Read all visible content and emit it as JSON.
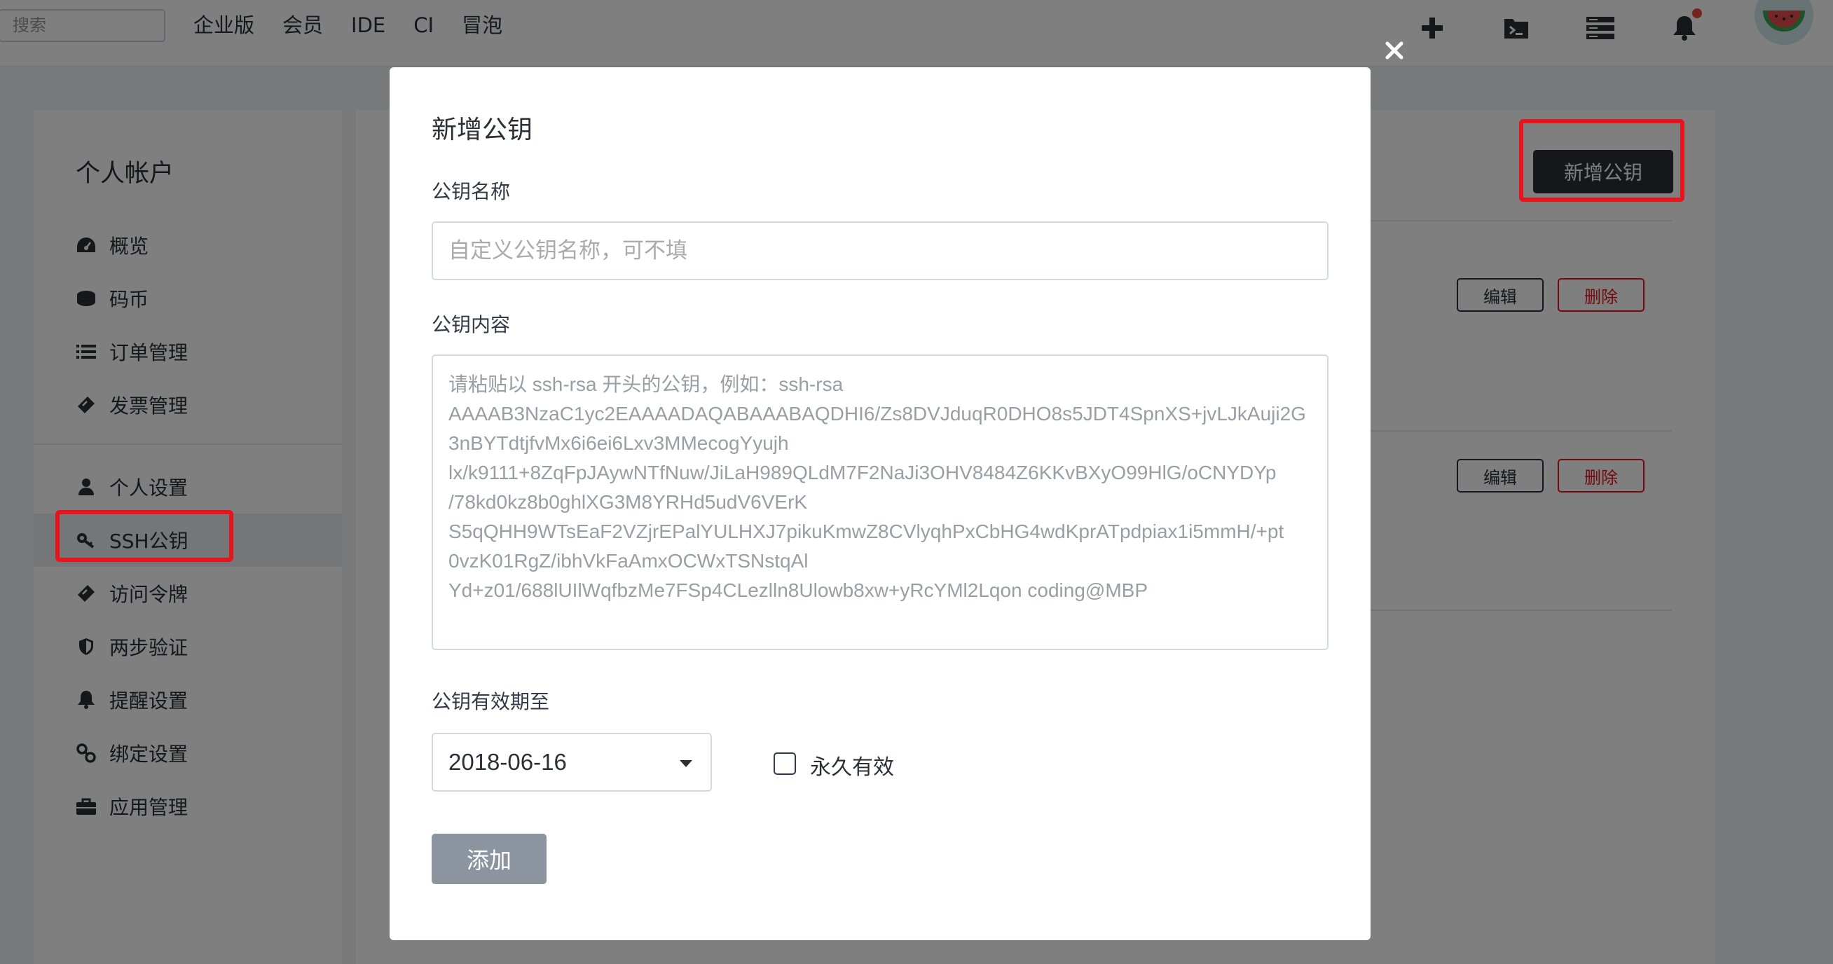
{
  "topbar": {
    "search_placeholder": "搜索",
    "nav": [
      "企业版",
      "会员",
      "IDE",
      "CI",
      "冒泡"
    ],
    "icons": [
      "plus-icon",
      "terminal-folder-icon",
      "server-icon",
      "bell-icon"
    ],
    "avatar": "watermelon-avatar"
  },
  "sidebar": {
    "title": "个人帐户",
    "group1": [
      {
        "label": "概览",
        "icon": "dashboard-icon"
      },
      {
        "label": "码币",
        "icon": "coins-icon"
      },
      {
        "label": "订单管理",
        "icon": "list-icon"
      },
      {
        "label": "发票管理",
        "icon": "ticket-icon"
      }
    ],
    "group2": [
      {
        "label": "个人设置",
        "icon": "user-icon"
      },
      {
        "label": "SSH公钥",
        "icon": "key-icon",
        "active": true
      },
      {
        "label": "访问令牌",
        "icon": "ticket-icon"
      },
      {
        "label": "两步验证",
        "icon": "shield-icon"
      },
      {
        "label": "提醒设置",
        "icon": "bell-icon"
      },
      {
        "label": "绑定设置",
        "icon": "link-icon"
      },
      {
        "label": "应用管理",
        "icon": "briefcase-icon"
      }
    ]
  },
  "main": {
    "new_key_label": "新增公钥",
    "rows": [
      {
        "edit": "编辑",
        "delete": "删除"
      },
      {
        "edit": "编辑",
        "delete": "删除"
      }
    ]
  },
  "modal": {
    "title": "新增公钥",
    "name_label": "公钥名称",
    "name_placeholder": "自定义公钥名称，可不填",
    "content_label": "公钥内容",
    "content_placeholder_lines": [
      "请粘贴以 ssh-rsa 开头的公钥，例如：ssh-rsa",
      "AAAAB3NzaC1yc2EAAAADAQABAAABAQDHI6/Zs8DVJduqR0DHO8s5JDT4SpnXS+jvLJkAuji2G",
      "3nBYTdtjfvMx6i6ei6Lxv3MMecogYyujh",
      "lx/k9111+8ZqFpJAywNTfNuw/JiLaH989QLdM7F2NaJi3OHV8484Z6KKvBXyO99HlG/oCNYDYp",
      "/78kd0kz8b0ghlXG3M8YRHd5udV6VErK",
      "S5qQHH9WTsEaF2VZjrEPalYULHXJ7pikuKmwZ8CVlyqhPxCbHG4wdKprATpdpiax1i5mmH/+pt",
      "0vzK01RgZ/ibhVkFaAmxOCWxTSNstqAl",
      "Yd+z01/688lUIlWqfbzMe7FSp4CLezlln8Ulowb8xw+yRcYMl2Lqon coding@MBP"
    ],
    "expire_label": "公钥有效期至",
    "expire_value": "2018-06-16",
    "forever_label": "永久有效",
    "forever_checked": false,
    "submit_label": "添加"
  },
  "colors": {
    "highlight": "#e8141b",
    "primary_dark": "#2b2f36",
    "submit_disabled": "#8c959f"
  }
}
